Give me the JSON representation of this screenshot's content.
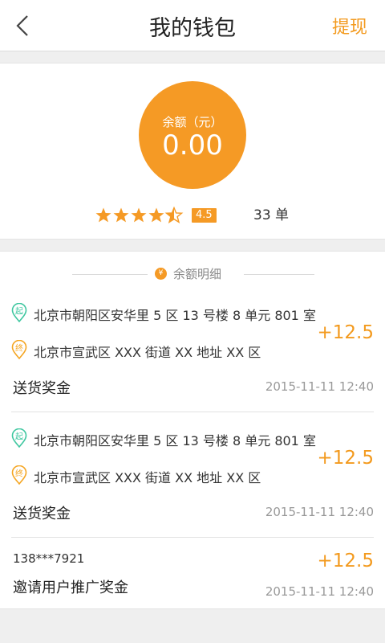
{
  "header": {
    "title": "我的钱包",
    "withdraw_label": "提现"
  },
  "balance": {
    "label": "余额（元）",
    "amount": "0.00"
  },
  "rating": {
    "stars": 4.5,
    "badge": "4.5 星",
    "orders": "33 单"
  },
  "detail": {
    "section_title": "余额明细",
    "items": [
      {
        "start_marker": "起",
        "start_address": "北京市朝阳区安华里 5 区 13 号楼 8 单元 801 室",
        "end_marker": "终",
        "end_address": "北京市宣武区 XXX 街道 XX 地址 XX 区",
        "amount": "+12.5",
        "description": "送货奖金",
        "time": "2015-11-11  12:40"
      },
      {
        "start_marker": "起",
        "start_address": "北京市朝阳区安华里 5 区 13 号楼 8 单元 801 室",
        "end_marker": "终",
        "end_address": "北京市宣武区 XXX 街道 XX 地址 XX 区",
        "amount": "+12.5",
        "description": "送货奖金",
        "time": "2015-11-11  12:40"
      },
      {
        "phone": "138***7921",
        "amount": "+12.5",
        "description": "邀请用户推广奖金",
        "time": "2015-11-11  12:40"
      }
    ]
  },
  "colors": {
    "accent": "#f59a25",
    "start_green": "#3fc7a0",
    "end_orange": "#f5a623"
  }
}
